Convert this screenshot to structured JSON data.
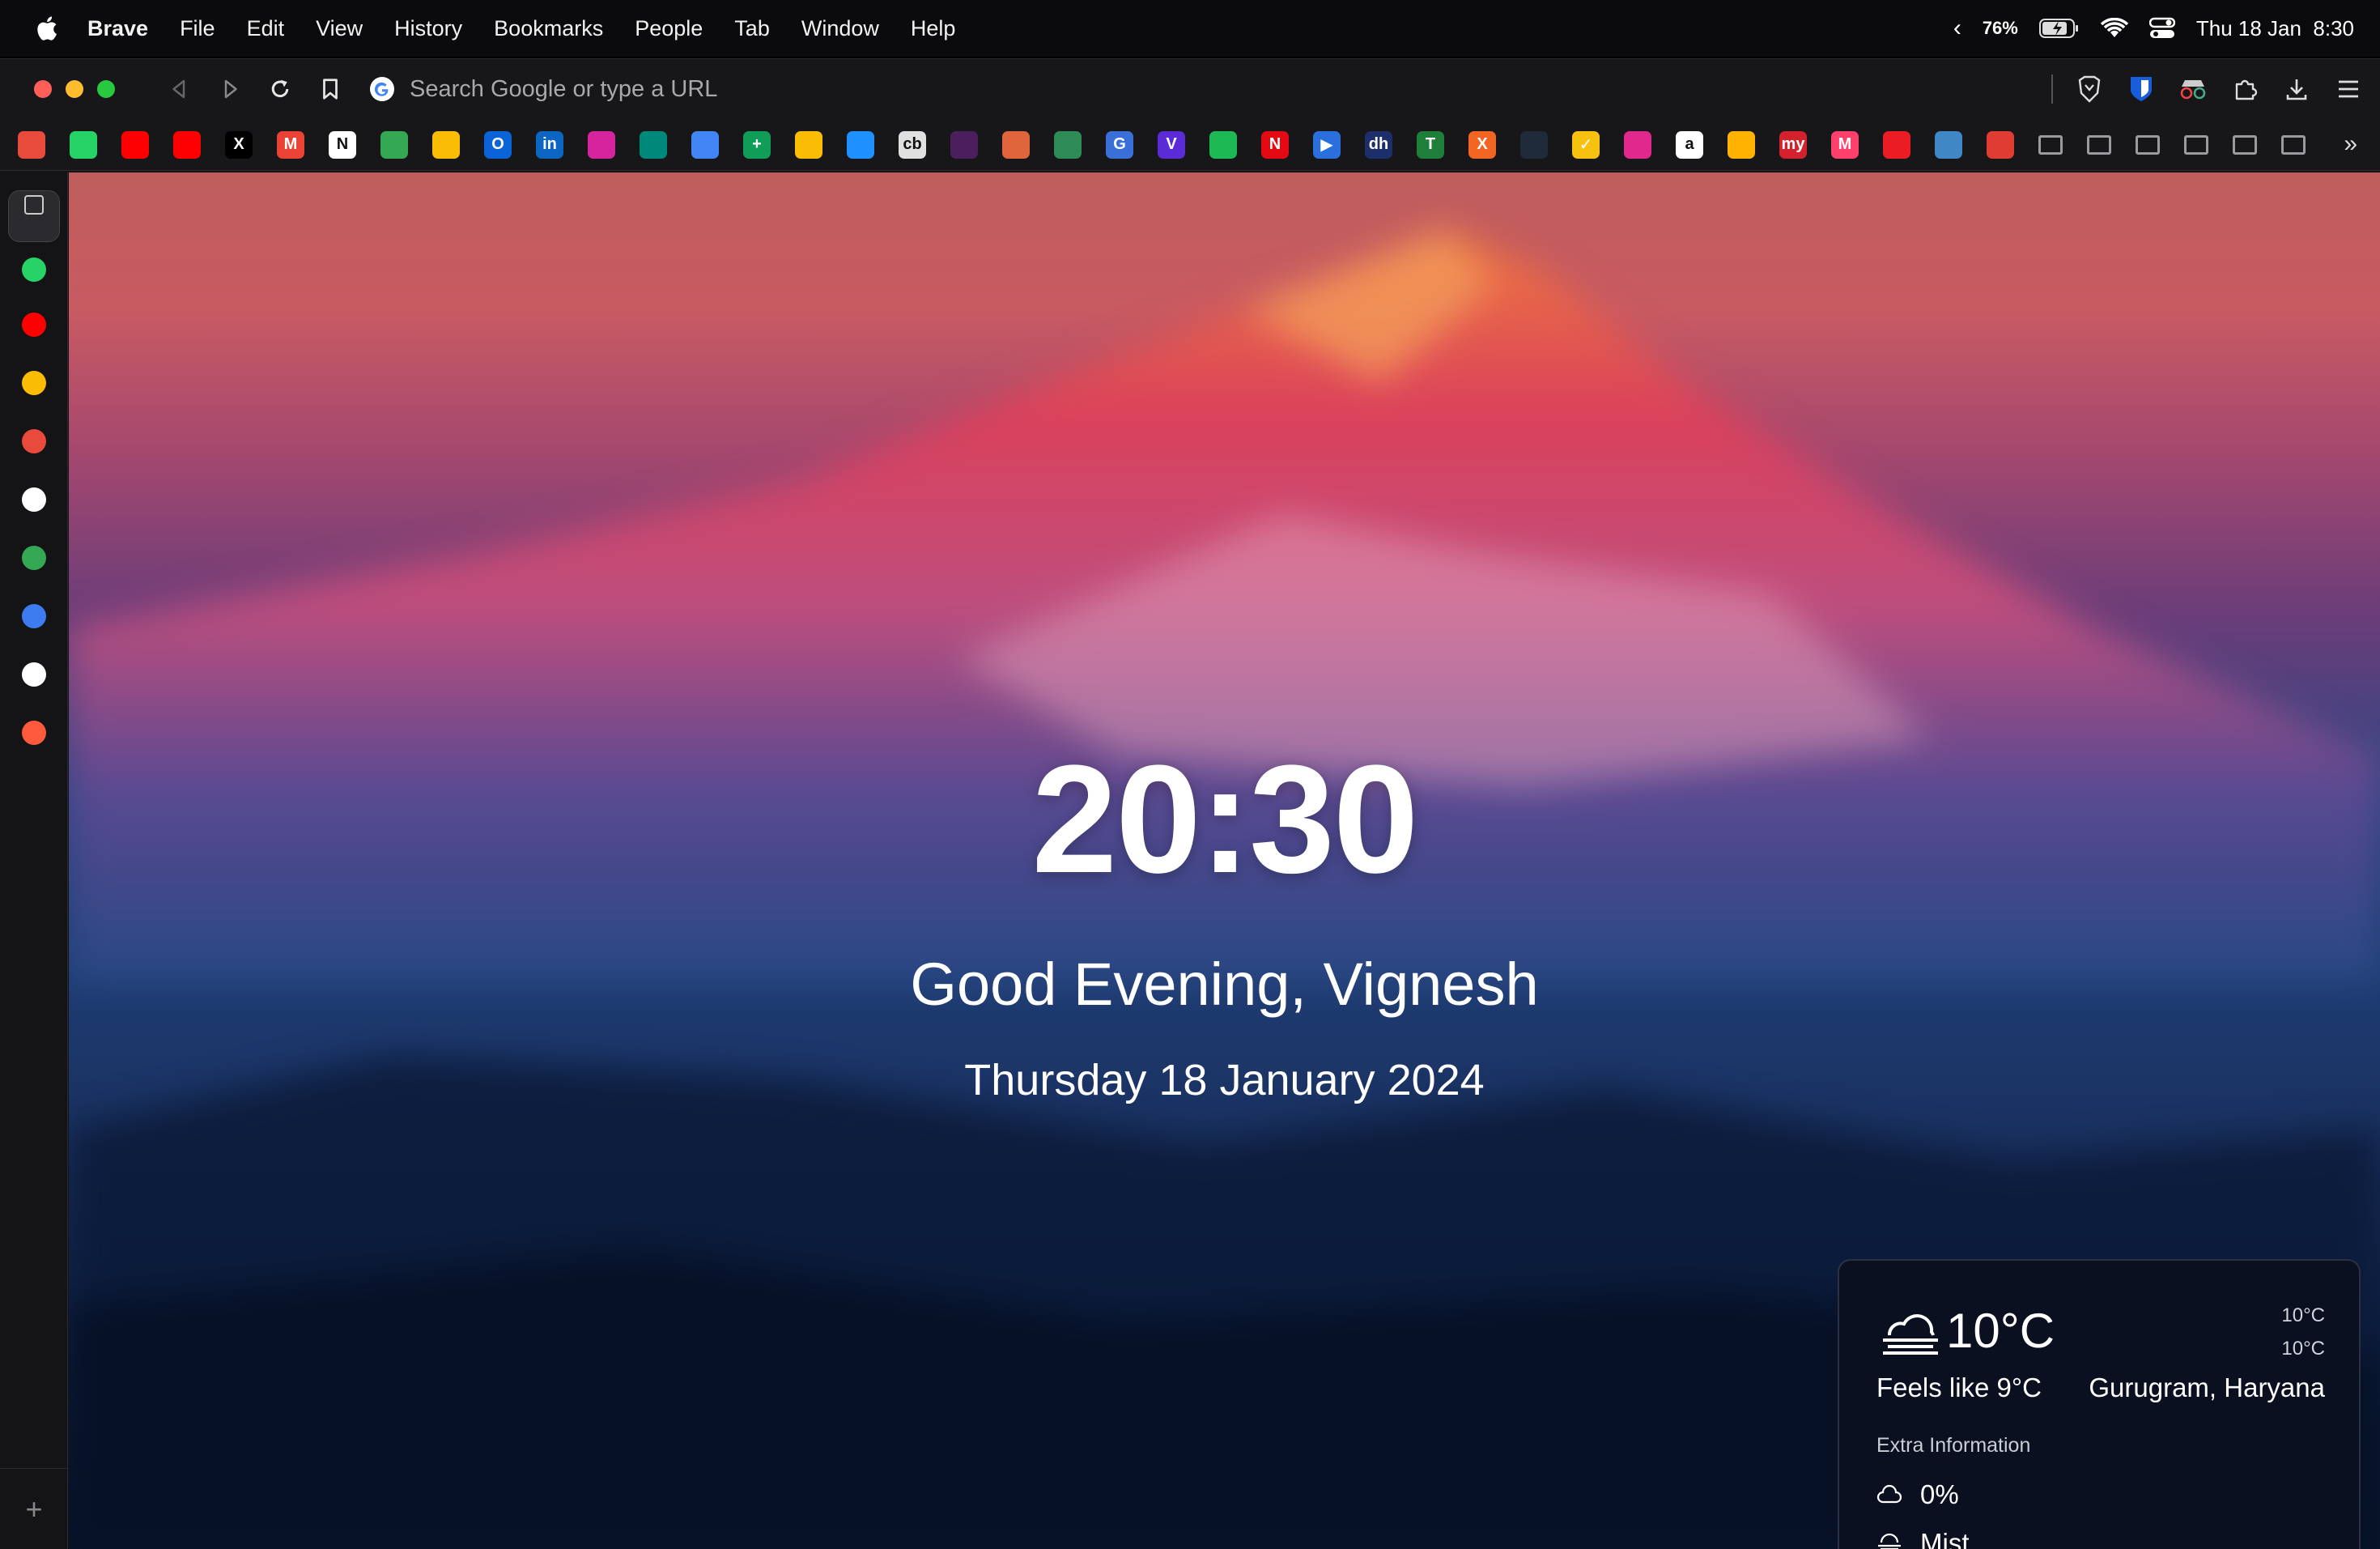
{
  "menubar": {
    "app_name": "Brave",
    "items": [
      "File",
      "Edit",
      "View",
      "History",
      "Bookmarks",
      "People",
      "Tab",
      "Window",
      "Help"
    ],
    "battery": "76%",
    "datetime": "Thu 18 Jan  8:30"
  },
  "toolbar": {
    "url_placeholder": "Search Google or type a URL"
  },
  "bookmarks": {
    "items": [
      {
        "name": "bookmark-store",
        "color": "#e84a3c",
        "glyph": ""
      },
      {
        "name": "bookmark-whatsapp",
        "color": "#25d366",
        "glyph": ""
      },
      {
        "name": "bookmark-youtube",
        "color": "#ff0000",
        "glyph": ""
      },
      {
        "name": "bookmark-youtube-music",
        "color": "#ff0000",
        "glyph": ""
      },
      {
        "name": "bookmark-x",
        "color": "#000000",
        "glyph": "X"
      },
      {
        "name": "bookmark-gmail",
        "color": "#ea4335",
        "glyph": "M"
      },
      {
        "name": "bookmark-notion",
        "color": "#ffffff",
        "glyph": "N"
      },
      {
        "name": "bookmark-drive",
        "color": "#34a853",
        "glyph": ""
      },
      {
        "name": "bookmark-photos",
        "color": "#fbbc04",
        "glyph": ""
      },
      {
        "name": "bookmark-outlook",
        "color": "#0a64d8",
        "glyph": "O"
      },
      {
        "name": "bookmark-linkedin",
        "color": "#0a66c2",
        "glyph": "in"
      },
      {
        "name": "bookmark-instagram",
        "color": "#d6249f",
        "glyph": ""
      },
      {
        "name": "bookmark-meet",
        "color": "#00897b",
        "glyph": ""
      },
      {
        "name": "bookmark-docs",
        "color": "#4285f4",
        "glyph": ""
      },
      {
        "name": "bookmark-sheets",
        "color": "#0f9d58",
        "glyph": "+"
      },
      {
        "name": "bookmark-keep",
        "color": "#fbbc04",
        "glyph": ""
      },
      {
        "name": "bookmark-safari",
        "color": "#1e90ff",
        "glyph": ""
      },
      {
        "name": "bookmark-cb",
        "color": "#e0e0e0",
        "glyph": "cb"
      },
      {
        "name": "bookmark-moon",
        "color": "#4b1f5e",
        "glyph": ""
      },
      {
        "name": "bookmark-tile-orange",
        "color": "#e0643c",
        "glyph": ""
      },
      {
        "name": "bookmark-tile-green",
        "color": "#2e8b57",
        "glyph": ""
      },
      {
        "name": "bookmark-gs",
        "color": "#3b6fd8",
        "glyph": "G"
      },
      {
        "name": "bookmark-v",
        "color": "#5b2bd8",
        "glyph": "V"
      },
      {
        "name": "bookmark-spotify",
        "color": "#1db954",
        "glyph": ""
      },
      {
        "name": "bookmark-netflix",
        "color": "#e50914",
        "glyph": "N"
      },
      {
        "name": "bookmark-play",
        "color": "#2a6fdb",
        "glyph": "▶"
      },
      {
        "name": "bookmark-dh",
        "color": "#1c2f6b",
        "glyph": "dh"
      },
      {
        "name": "bookmark-tv",
        "color": "#1e7f3a",
        "glyph": "T"
      },
      {
        "name": "bookmark-x-orange",
        "color": "#f26522",
        "glyph": "X"
      },
      {
        "name": "bookmark-game",
        "color": "#1f2a3a",
        "glyph": ""
      },
      {
        "name": "bookmark-check",
        "color": "#f6c20f",
        "glyph": "✓"
      },
      {
        "name": "bookmark-pink",
        "color": "#e0288d",
        "glyph": ""
      },
      {
        "name": "bookmark-amazon",
        "color": "#ffffff",
        "glyph": "a"
      },
      {
        "name": "bookmark-bolt",
        "color": "#ffb300",
        "glyph": ""
      },
      {
        "name": "bookmark-my",
        "color": "#d3212d",
        "glyph": "my"
      },
      {
        "name": "bookmark-myntra",
        "color": "#ff3f6c",
        "glyph": "M"
      },
      {
        "name": "bookmark-acrobat",
        "color": "#ec1c24",
        "glyph": ""
      },
      {
        "name": "bookmark-blue-tile",
        "color": "#3f88c5",
        "glyph": ""
      },
      {
        "name": "bookmark-red-arrow",
        "color": "#e03c31",
        "glyph": ""
      },
      {
        "name": "bookmark-folder-1",
        "color": "#9a9aa0",
        "glyph": ""
      },
      {
        "name": "bookmark-folder-2",
        "color": "#9a9aa0",
        "glyph": ""
      },
      {
        "name": "bookmark-folder-3",
        "color": "#9a9aa0",
        "glyph": ""
      },
      {
        "name": "bookmark-folder-4",
        "color": "#9a9aa0",
        "glyph": ""
      },
      {
        "name": "bookmark-folder-5",
        "color": "#9a9aa0",
        "glyph": ""
      },
      {
        "name": "bookmark-folder-6",
        "color": "#9a9aa0",
        "glyph": ""
      }
    ]
  },
  "sidebar": {
    "items": [
      {
        "name": "sidebar-toggle",
        "color": "#cccccc"
      },
      {
        "name": "sidebar-whatsapp",
        "color": "#25d366"
      },
      {
        "name": "sidebar-youtube",
        "color": "#ff0000"
      },
      {
        "name": "sidebar-chrome",
        "color": "#fbbc04"
      },
      {
        "name": "sidebar-store",
        "color": "#e84a3c"
      },
      {
        "name": "sidebar-medium",
        "color": "#ffffff"
      },
      {
        "name": "sidebar-drive",
        "color": "#34a853"
      },
      {
        "name": "sidebar-extensions",
        "color": "#3d7cf0"
      },
      {
        "name": "sidebar-github",
        "color": "#ffffff"
      },
      {
        "name": "sidebar-assistant",
        "color": "#ff5a3c"
      }
    ],
    "add_label": "+"
  },
  "newtab": {
    "time": "20:30",
    "greeting": "Good Evening, Vignesh",
    "date": "Thursday 18 January 2024"
  },
  "weather": {
    "temperature": "10°C",
    "high": "10°C",
    "low": "10°C",
    "feels_like": "Feels like 9°C",
    "location": "Gurugram, Haryana",
    "extra_label": "Extra Information",
    "cloud_cover": "0%",
    "condition": "Mist",
    "icon": "mist-icon"
  }
}
